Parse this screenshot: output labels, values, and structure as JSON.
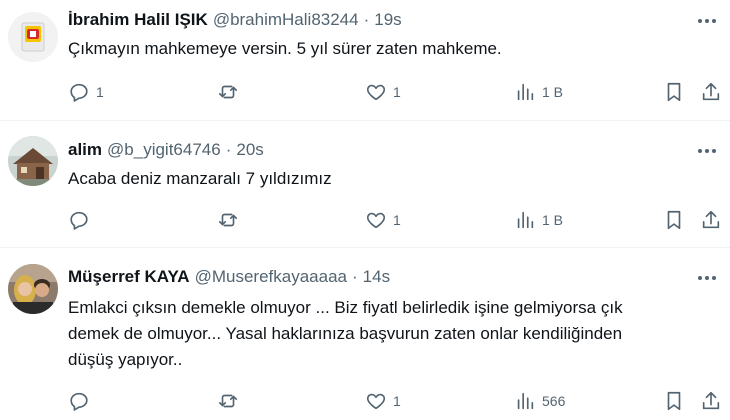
{
  "tweets": [
    {
      "name": "İbrahim Halil IŞIK",
      "handle": "@brahimHali83244",
      "separator": "·",
      "time": "19s",
      "text_lines": [
        "Çıkmayın mahkemeye versin. 5 yıl sürer zaten mahkeme."
      ],
      "actions": {
        "replies": "1",
        "retweets": "",
        "likes": "1",
        "views": "1 B"
      },
      "avatar_icon": "electrical-switch-icon"
    },
    {
      "name": "alim",
      "handle": "@b_yigit64746",
      "separator": "·",
      "time": "20s",
      "text_lines": [
        "Acaba deniz manzaralı 7 yıldızımız"
      ],
      "actions": {
        "replies": "",
        "retweets": "",
        "likes": "1",
        "views": "1 B"
      },
      "avatar_icon": "cabin-photo-icon"
    },
    {
      "name": "Müşerref KAYA",
      "handle": "@Muserefkayaaaaa",
      "separator": "·",
      "time": "14s",
      "text_lines": [
        "Emlakci çıksın demekle olmuyor ... Biz fiyatl belirledik işine gelmiyorsa çık",
        "demek de olmuyor... Yasal haklarınıza başvurun zaten onlar kendiliğinden",
        "düşüş yapıyor.."
      ],
      "actions": {
        "replies": "",
        "retweets": "",
        "likes": "1",
        "views": "566"
      },
      "avatar_icon": "couple-photo-icon"
    }
  ],
  "colors": {
    "text": "#0f1419",
    "secondary": "#536471",
    "divider": "#eff3f4"
  }
}
